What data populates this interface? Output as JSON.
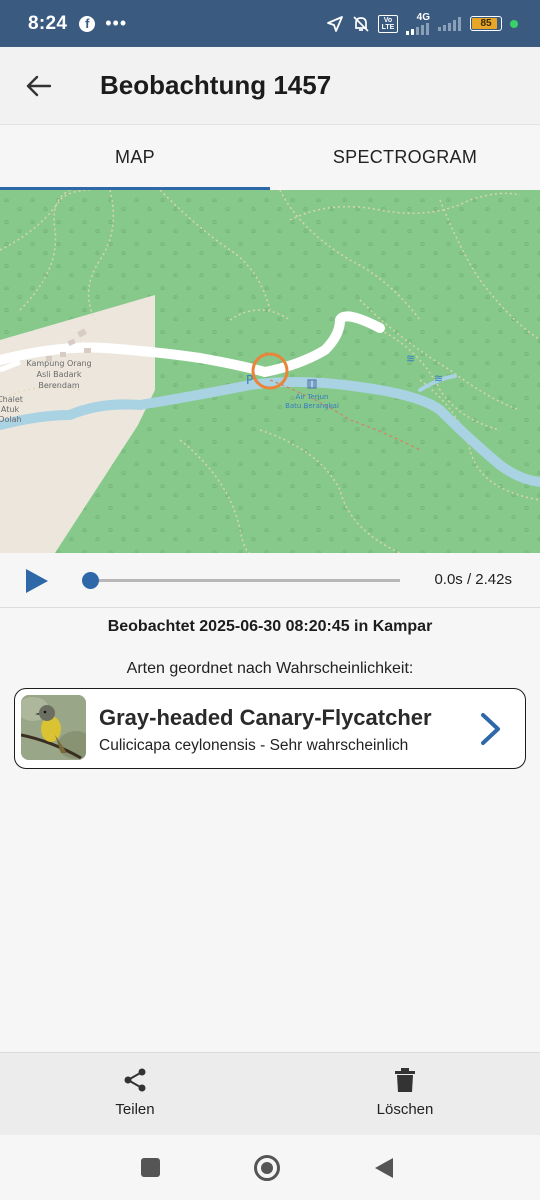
{
  "status_bar": {
    "time": "8:24",
    "network_label": "4G",
    "volte_label": "Vo LTE",
    "battery_level": "85",
    "icons": [
      "facebook-icon",
      "more-icon",
      "location-arrow-icon",
      "mute-bell-icon",
      "volte-icon",
      "signal-icon",
      "signal-2-icon",
      "battery-icon",
      "green-dot-icon"
    ]
  },
  "app_bar": {
    "title": "Beobachtung 1457",
    "back_icon": "arrow-back-icon"
  },
  "tabs": [
    {
      "label": "MAP",
      "active": true
    },
    {
      "label": "SPECTROGRAM",
      "active": false
    }
  ],
  "map": {
    "labels": {
      "village_line1": "Kampung Orang",
      "village_line2": "Asli Badark",
      "village_line3": "Berendam",
      "chalet_line1": "Chalet",
      "chalet_line2": "Atuk",
      "chalet_line3": "Dolah",
      "waterfall_line1": "Air Terjun",
      "waterfall_line2": "Batu Berangkai",
      "parking": "P"
    },
    "colors": {
      "forest": "#86c98a",
      "urban": "#ece6dd",
      "river": "#a9d2e2",
      "road": "#ffffff",
      "marker": "#e9843a"
    }
  },
  "player": {
    "progress": 0.0,
    "time_readout": "0.0s / 2.42s"
  },
  "observation": {
    "observed_text": "Beobachtet 2025-06-30 08:20:45 in Kampar",
    "sorted_label": "Arten geordnet nach Wahrscheinlichkeit:"
  },
  "species": [
    {
      "common_name": "Gray-headed Canary-Flycatcher",
      "scientific_line": "Culicicapa ceylonensis - Sehr wahrscheinlich"
    }
  ],
  "actions": {
    "share_label": "Teilen",
    "delete_label": "Löschen"
  },
  "accent_color": "#2f68a8"
}
